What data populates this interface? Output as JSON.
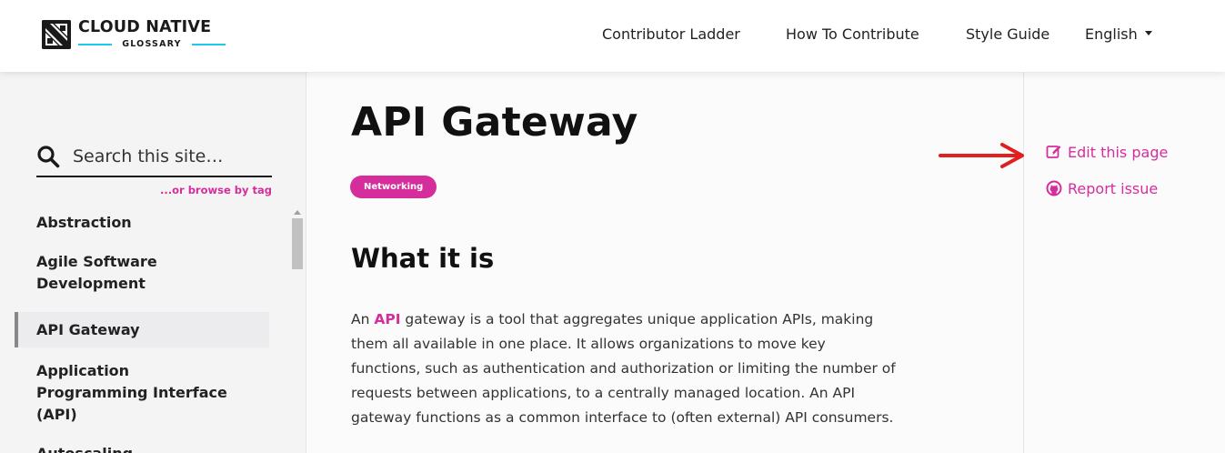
{
  "brand": {
    "title": "CLOUD NATIVE",
    "subtitle": "GLOSSARY"
  },
  "nav": {
    "items": [
      {
        "label": "Contributor Ladder"
      },
      {
        "label": "How To Contribute"
      },
      {
        "label": "Style Guide"
      }
    ],
    "language": "English"
  },
  "sidebar": {
    "search_placeholder": "Search this site…",
    "browse_tag": "...or browse by tag",
    "items": [
      {
        "label": "Abstraction",
        "active": false
      },
      {
        "label": "Agile Software Development",
        "active": false
      },
      {
        "label": "API Gateway",
        "active": true
      },
      {
        "label": "Application Programming Interface (API)",
        "active": false
      },
      {
        "label": "Autoscaling",
        "active": false
      }
    ]
  },
  "main": {
    "title": "API Gateway",
    "tag": "Networking",
    "section_title": "What it is",
    "paragraph": {
      "prefix": "An ",
      "link": "API",
      "line1_rest": " gateway is a tool that aggregates unique application APIs, making",
      "line2": "them all available in one place. It allows organizations to move key",
      "line3": "functions, such as authentication and authorization or limiting the number of",
      "line4": "requests between applications, to a centrally managed location. An API",
      "line5": "gateway functions as a common interface to (often external) API consumers."
    }
  },
  "page_meta": {
    "edit_label": "Edit this page",
    "issue_label": "Report issue"
  },
  "colors": {
    "accent": "#d62d9d",
    "logo_line": "#1ec8e8",
    "annotation_arrow": "#e02020"
  },
  "icons": {
    "search": "search-icon",
    "edit": "edit-icon",
    "github": "github-icon",
    "arrow": "red-arrow-icon"
  }
}
